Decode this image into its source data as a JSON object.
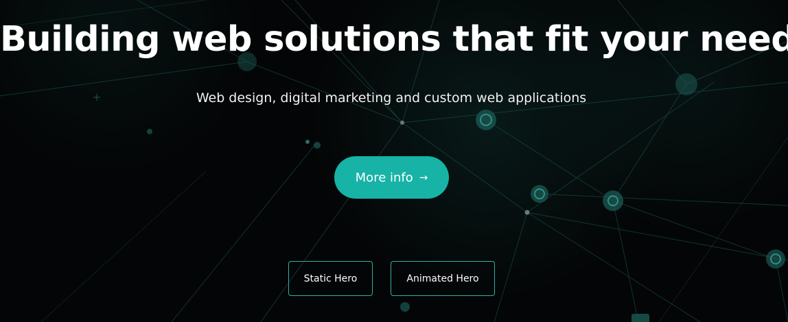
{
  "hero": {
    "headline": "Building web solutions that fit your needs",
    "subheadline": "Web design, digital marketing and custom web applications",
    "cta": {
      "label": "More info",
      "icon": "arrow-right-icon",
      "color": "#17b3a6"
    },
    "buttons": [
      {
        "label": "Static Hero"
      },
      {
        "label": "Animated Hero"
      }
    ],
    "accent_border_color": "#2fb3a8",
    "background_color": "#040506",
    "network_color": "#1f6f66"
  }
}
